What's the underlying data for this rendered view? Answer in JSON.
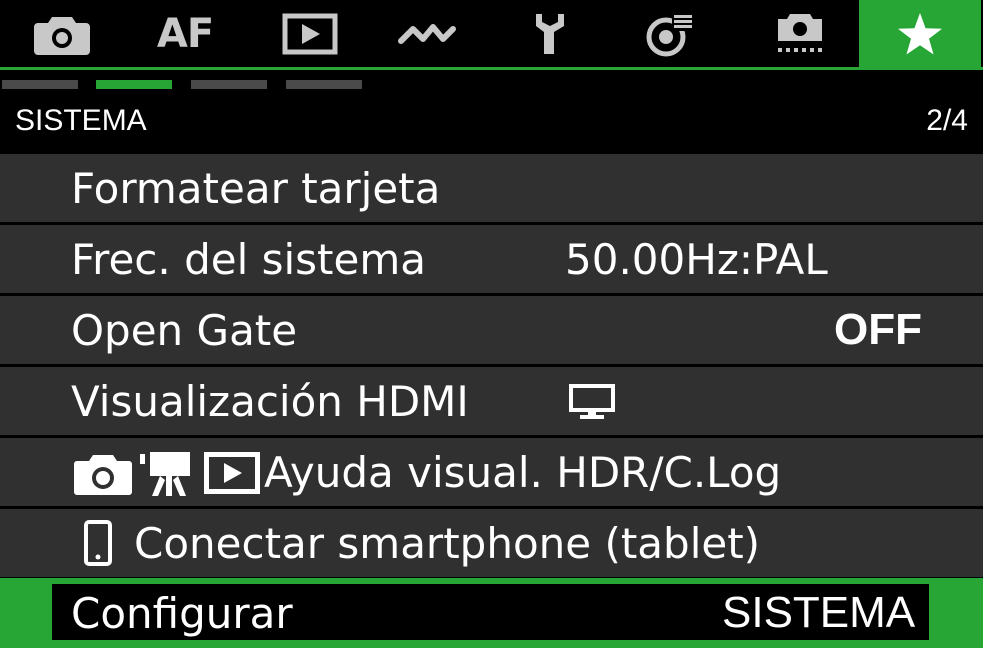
{
  "tabs": [
    {
      "id": "shooting",
      "icon": "camera-icon"
    },
    {
      "id": "af",
      "label": "AF"
    },
    {
      "id": "playback",
      "icon": "play-icon"
    },
    {
      "id": "wireless",
      "icon": "wireless-icon"
    },
    {
      "id": "setup",
      "icon": "wrench-icon"
    },
    {
      "id": "custom",
      "icon": "custom-functions-icon"
    },
    {
      "id": "mymenu",
      "icon": "my-menu-icon"
    },
    {
      "id": "favorites",
      "icon": "star-icon",
      "active": true
    }
  ],
  "colors": {
    "accent": "#27a636",
    "row_bg": "#303030",
    "text": "#ffffff"
  },
  "page_indicator": {
    "pages": 4,
    "current": 2
  },
  "section": {
    "title": "SISTEMA",
    "page": "2/4"
  },
  "menu": {
    "row1": {
      "label": "Formatear tarjeta"
    },
    "row2": {
      "label": "Frec. del sistema",
      "value": "50.00Hz:PAL"
    },
    "row3": {
      "label": "Open Gate",
      "value": "OFF"
    },
    "row4": {
      "label": "Visualización HDMI",
      "value_icon": "monitor-icon"
    },
    "row5": {
      "label": "Ayuda visual. HDR/C.Log",
      "icons": [
        "camera-icon",
        "movie-camera-icon",
        "play-icon"
      ]
    },
    "row6": {
      "label": "Conectar smartphone (tablet)",
      "icon": "smartphone-icon"
    },
    "row7": {
      "label": "Configurar",
      "value": "SISTEMA",
      "selected": true
    }
  }
}
